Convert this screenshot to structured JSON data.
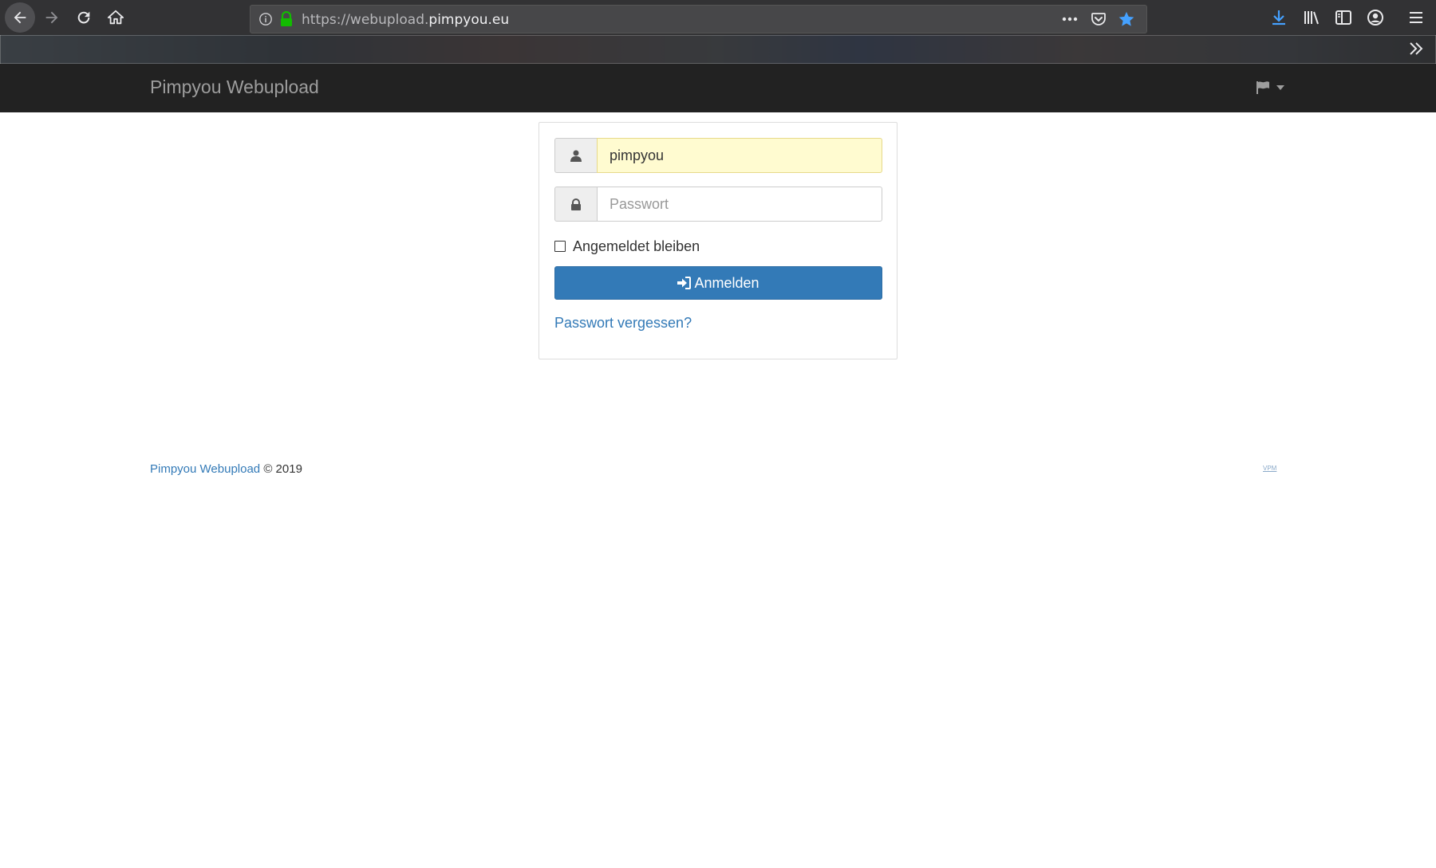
{
  "browser": {
    "url_prefix": "https://webupload.",
    "url_domain": "pimpyou.eu",
    "icons": {
      "back": "arrow-left-icon",
      "forward": "arrow-right-icon",
      "reload": "reload-icon",
      "home": "home-icon",
      "info": "info-icon",
      "lock": "lock-icon",
      "more": "ellipsis-icon",
      "pocket": "pocket-icon",
      "bookmark": "star-icon",
      "download": "download-icon",
      "library": "library-icon",
      "sidebar": "sidebar-icon",
      "account": "account-icon",
      "menu": "hamburger-icon",
      "overflow": "chevron-double-right-icon"
    },
    "colors": {
      "lock": "#12bc00",
      "star": "#45a1ff",
      "download": "#45a1ff"
    }
  },
  "navbar": {
    "brand": "Pimpyou Webupload",
    "language_icon": "flag-icon"
  },
  "login": {
    "username_value": "pimpyou",
    "password_placeholder": "Passwort",
    "remember_label": "Angemeldet bleiben",
    "submit_label": "Anmelden",
    "forgot_label": "Passwort vergessen?",
    "colors": {
      "primary": "#337ab7",
      "autofill": "#fffbd0"
    }
  },
  "footer": {
    "brand_link": "Pimpyou Webupload",
    "copyright": "© 2019",
    "right_link": "VPM"
  }
}
